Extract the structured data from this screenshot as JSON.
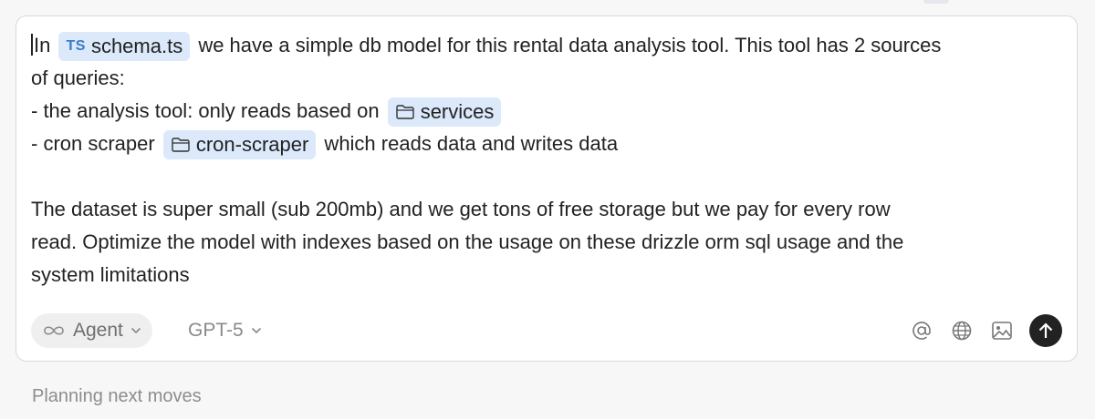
{
  "prompt": {
    "line1_prefix": "In",
    "chip_schema_tag": "TS",
    "chip_schema_label": "schema.ts",
    "line1_suffix": " we have a simple db model for this rental data analysis tool. This tool has 2 sources",
    "line2": "of queries:",
    "line3_prefix": "- the analysis tool: only reads based on ",
    "chip_services_label": "services",
    "line4_prefix": "- cron scraper ",
    "chip_cron_label": "cron-scraper",
    "line4_suffix": " which reads data and writes data",
    "line6": "The dataset is super small (sub 200mb) and we get tons of free storage but we pay for every row",
    "line7": "read. Optimize the model with indexes based on the usage on these drizzle orm sql usage and the",
    "line8": "system limitations"
  },
  "toolbar": {
    "mode_label": "Agent",
    "mode_icon": "infinity-icon",
    "model_label": "GPT-5",
    "mention_icon": "at-icon",
    "web_icon": "globe-icon",
    "image_icon": "image-icon",
    "send_icon": "arrow-up-icon"
  },
  "status": {
    "text": "Planning next moves"
  },
  "colors": {
    "chip_bg": "#dbe9fb",
    "ts_tag": "#3b7bc7",
    "send_bg": "#222222"
  }
}
